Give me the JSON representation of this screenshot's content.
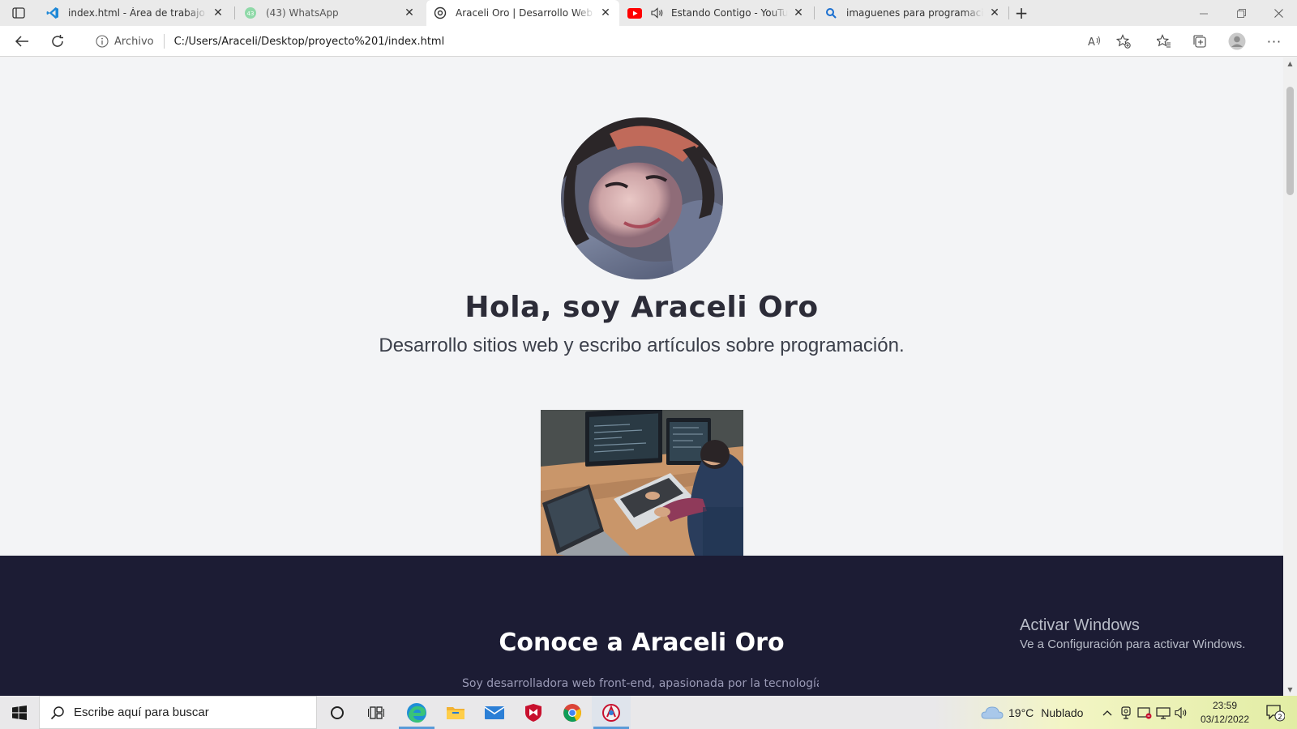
{
  "browser": {
    "tabs": [
      {
        "title": "index.html - Área de trabajo - Visual Studio Code",
        "icon": "vscode-icon"
      },
      {
        "title": "(43) WhatsApp",
        "icon": "whatsapp-icon",
        "badge": "43"
      },
      {
        "title": "Araceli Oro | Desarrollo Web Front-End",
        "icon": "page-icon"
      },
      {
        "title": "Estando Contigo - YouTube",
        "icon": "youtube-icon"
      },
      {
        "title": "imaguenes para programacion web - Buscar",
        "icon": "search-icon"
      }
    ],
    "address": {
      "origin_label": "Archivo",
      "url": "C:/Users/Araceli/Desktop/proyecto%201/index.html"
    }
  },
  "page": {
    "hero_title": "Hola, soy Araceli Oro",
    "hero_subtitle": "Desarrollo sitios web y escribo artículos sobre programación.",
    "about_title": "Conoce a Araceli Oro",
    "about_peek": "Soy desarrolladora web front-end, apasionada por la tecnología."
  },
  "watermark": {
    "line1": "Activar Windows",
    "line2": "Ve a Configuración para activar Windows."
  },
  "taskbar": {
    "search_placeholder": "Escribe aquí para buscar",
    "weather_temp": "19°C",
    "weather_text": "Nublado",
    "time": "23:59",
    "date": "03/12/2022",
    "notification_count": "2"
  },
  "colors": {
    "dark_section": "#1c1c34",
    "page_bg": "#f3f4f6",
    "accent": "#0067c0"
  }
}
